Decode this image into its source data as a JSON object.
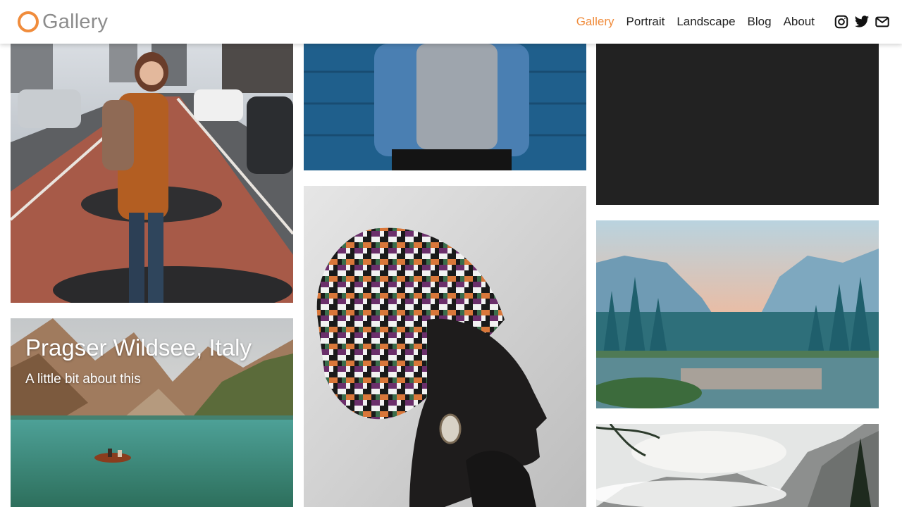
{
  "brand": {
    "name": "Gallery",
    "accent_color": "#f08c3c"
  },
  "nav": {
    "items": [
      {
        "label": "Gallery",
        "active": true
      },
      {
        "label": "Portrait",
        "active": false
      },
      {
        "label": "Landscape",
        "active": false
      },
      {
        "label": "Blog",
        "active": false
      },
      {
        "label": "About",
        "active": false
      }
    ],
    "social": [
      "instagram-icon",
      "twitter-icon",
      "mail-icon"
    ]
  },
  "gallery": {
    "tiles": [
      {
        "subject": "woman with backpack on city bike lane"
      },
      {
        "subject": "lake with rowing boat and mountains",
        "caption_title": "Pragser Wildsee, Italy",
        "caption_subtitle": "A little bit about this"
      },
      {
        "subject": "person in denim jacket against blue wall"
      },
      {
        "subject": "woman with patterned head wrap"
      },
      {
        "subject": "dark placeholder"
      },
      {
        "subject": "valley river at sunset with pine trees"
      },
      {
        "subject": "foggy mountain peaks with tree"
      }
    ]
  }
}
